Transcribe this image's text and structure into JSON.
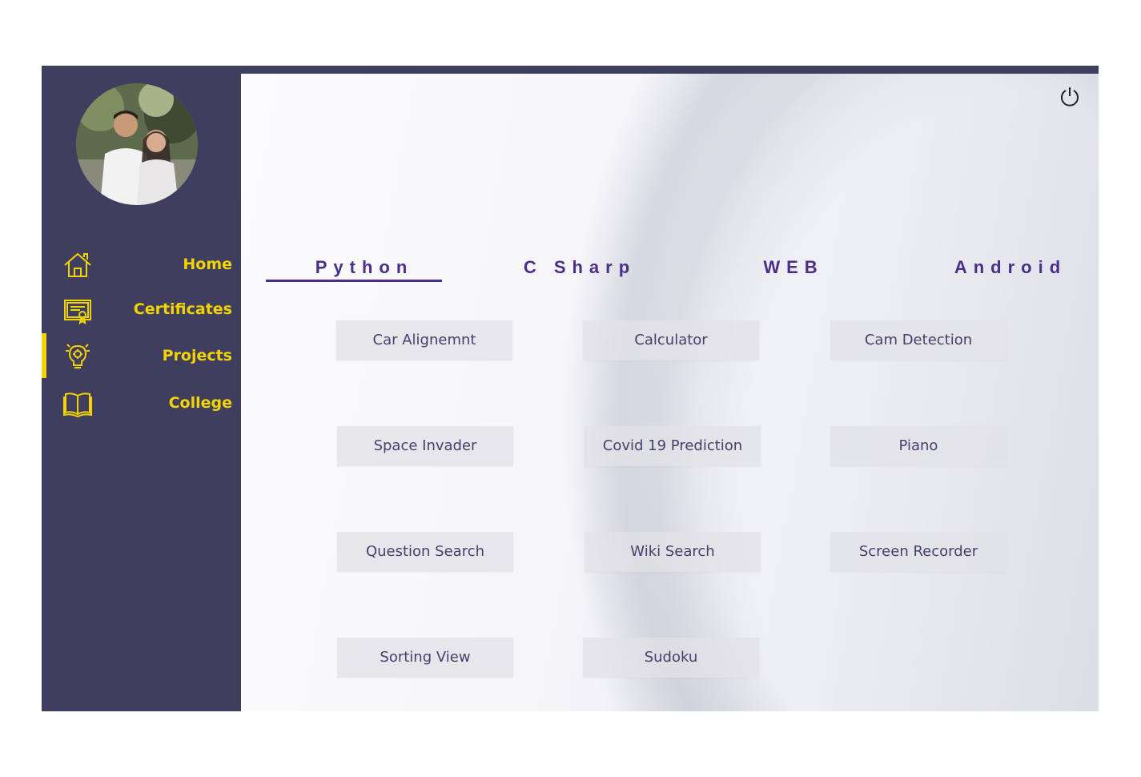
{
  "sidebar": {
    "avatar_alt": "",
    "items": [
      {
        "label": "Home",
        "icon": "home-icon"
      },
      {
        "label": "Certificates",
        "icon": "certificate-icon"
      },
      {
        "label": "Projects",
        "icon": "projects-icon"
      },
      {
        "label": "College",
        "icon": "book-icon"
      }
    ],
    "active_item": "Projects"
  },
  "header": {
    "power_icon": "power-icon"
  },
  "tabs": [
    {
      "label": "Python",
      "active": true
    },
    {
      "label": "C Sharp",
      "active": false
    },
    {
      "label": "WEB",
      "active": false
    },
    {
      "label": "Android",
      "active": false
    }
  ],
  "projects": [
    "Car Alignemnt",
    "Calculator",
    "Cam Detection",
    "Space Invader",
    "Covid 19 Prediction",
    "Piano",
    "Question Search",
    "Wiki Search",
    "Screen Recorder",
    "Sorting View",
    "Sudoku"
  ],
  "colors": {
    "sidebar_bg": "#403e5e",
    "accent_yellow": "#f2d400",
    "tab_purple": "#4a2e8c",
    "button_text": "#473e6e"
  }
}
